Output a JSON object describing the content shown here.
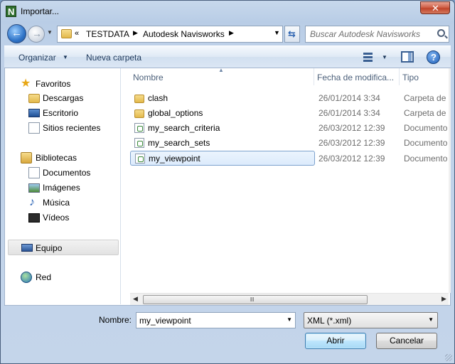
{
  "window": {
    "title": "Importar..."
  },
  "close_label": "✕",
  "address": {
    "overflow": "«",
    "segments": [
      "TESTDATA",
      "Autodesk Navisworks"
    ]
  },
  "search": {
    "placeholder": "Buscar Autodesk Navisworks"
  },
  "toolbar": {
    "organize": "Organizar",
    "new_folder": "Nueva carpeta"
  },
  "nav": {
    "favorites": {
      "label": "Favoritos",
      "icon": "star-icon"
    },
    "favorite_items": [
      {
        "label": "Descargas",
        "icon": "downloads-folder-icon"
      },
      {
        "label": "Escritorio",
        "icon": "desktop-icon"
      },
      {
        "label": "Sitios recientes",
        "icon": "recent-places-icon"
      }
    ],
    "libraries": {
      "label": "Bibliotecas",
      "icon": "libraries-icon"
    },
    "library_items": [
      {
        "label": "Documentos",
        "icon": "documents-icon"
      },
      {
        "label": "Imágenes",
        "icon": "pictures-icon"
      },
      {
        "label": "Música",
        "icon": "music-icon"
      },
      {
        "label": "Vídeos",
        "icon": "videos-icon"
      }
    ],
    "computer": {
      "label": "Equipo",
      "icon": "computer-icon",
      "selected": true
    },
    "network": {
      "label": "Red",
      "icon": "network-icon"
    }
  },
  "columns": [
    "Nombre",
    "Fecha de modifica...",
    "Tipo"
  ],
  "files": [
    {
      "name": "clash",
      "date": "26/01/2014 3:34",
      "type": "Carpeta de a",
      "kind": "folder"
    },
    {
      "name": "global_options",
      "date": "26/01/2014 3:34",
      "type": "Carpeta de a",
      "kind": "folder"
    },
    {
      "name": "my_search_criteria",
      "date": "26/03/2012 12:39",
      "type": "Documento",
      "kind": "xml"
    },
    {
      "name": "my_search_sets",
      "date": "26/03/2012 12:39",
      "type": "Documento",
      "kind": "xml"
    },
    {
      "name": "my_viewpoint",
      "date": "26/03/2012 12:39",
      "type": "Documento",
      "kind": "xml",
      "selected": true
    }
  ],
  "bottom": {
    "name_label": "Nombre:",
    "name_value": "my_viewpoint",
    "filter_value": "XML (*.xml)",
    "open_label": "Abrir",
    "cancel_label": "Cancelar"
  },
  "scroll_grip": "lll"
}
